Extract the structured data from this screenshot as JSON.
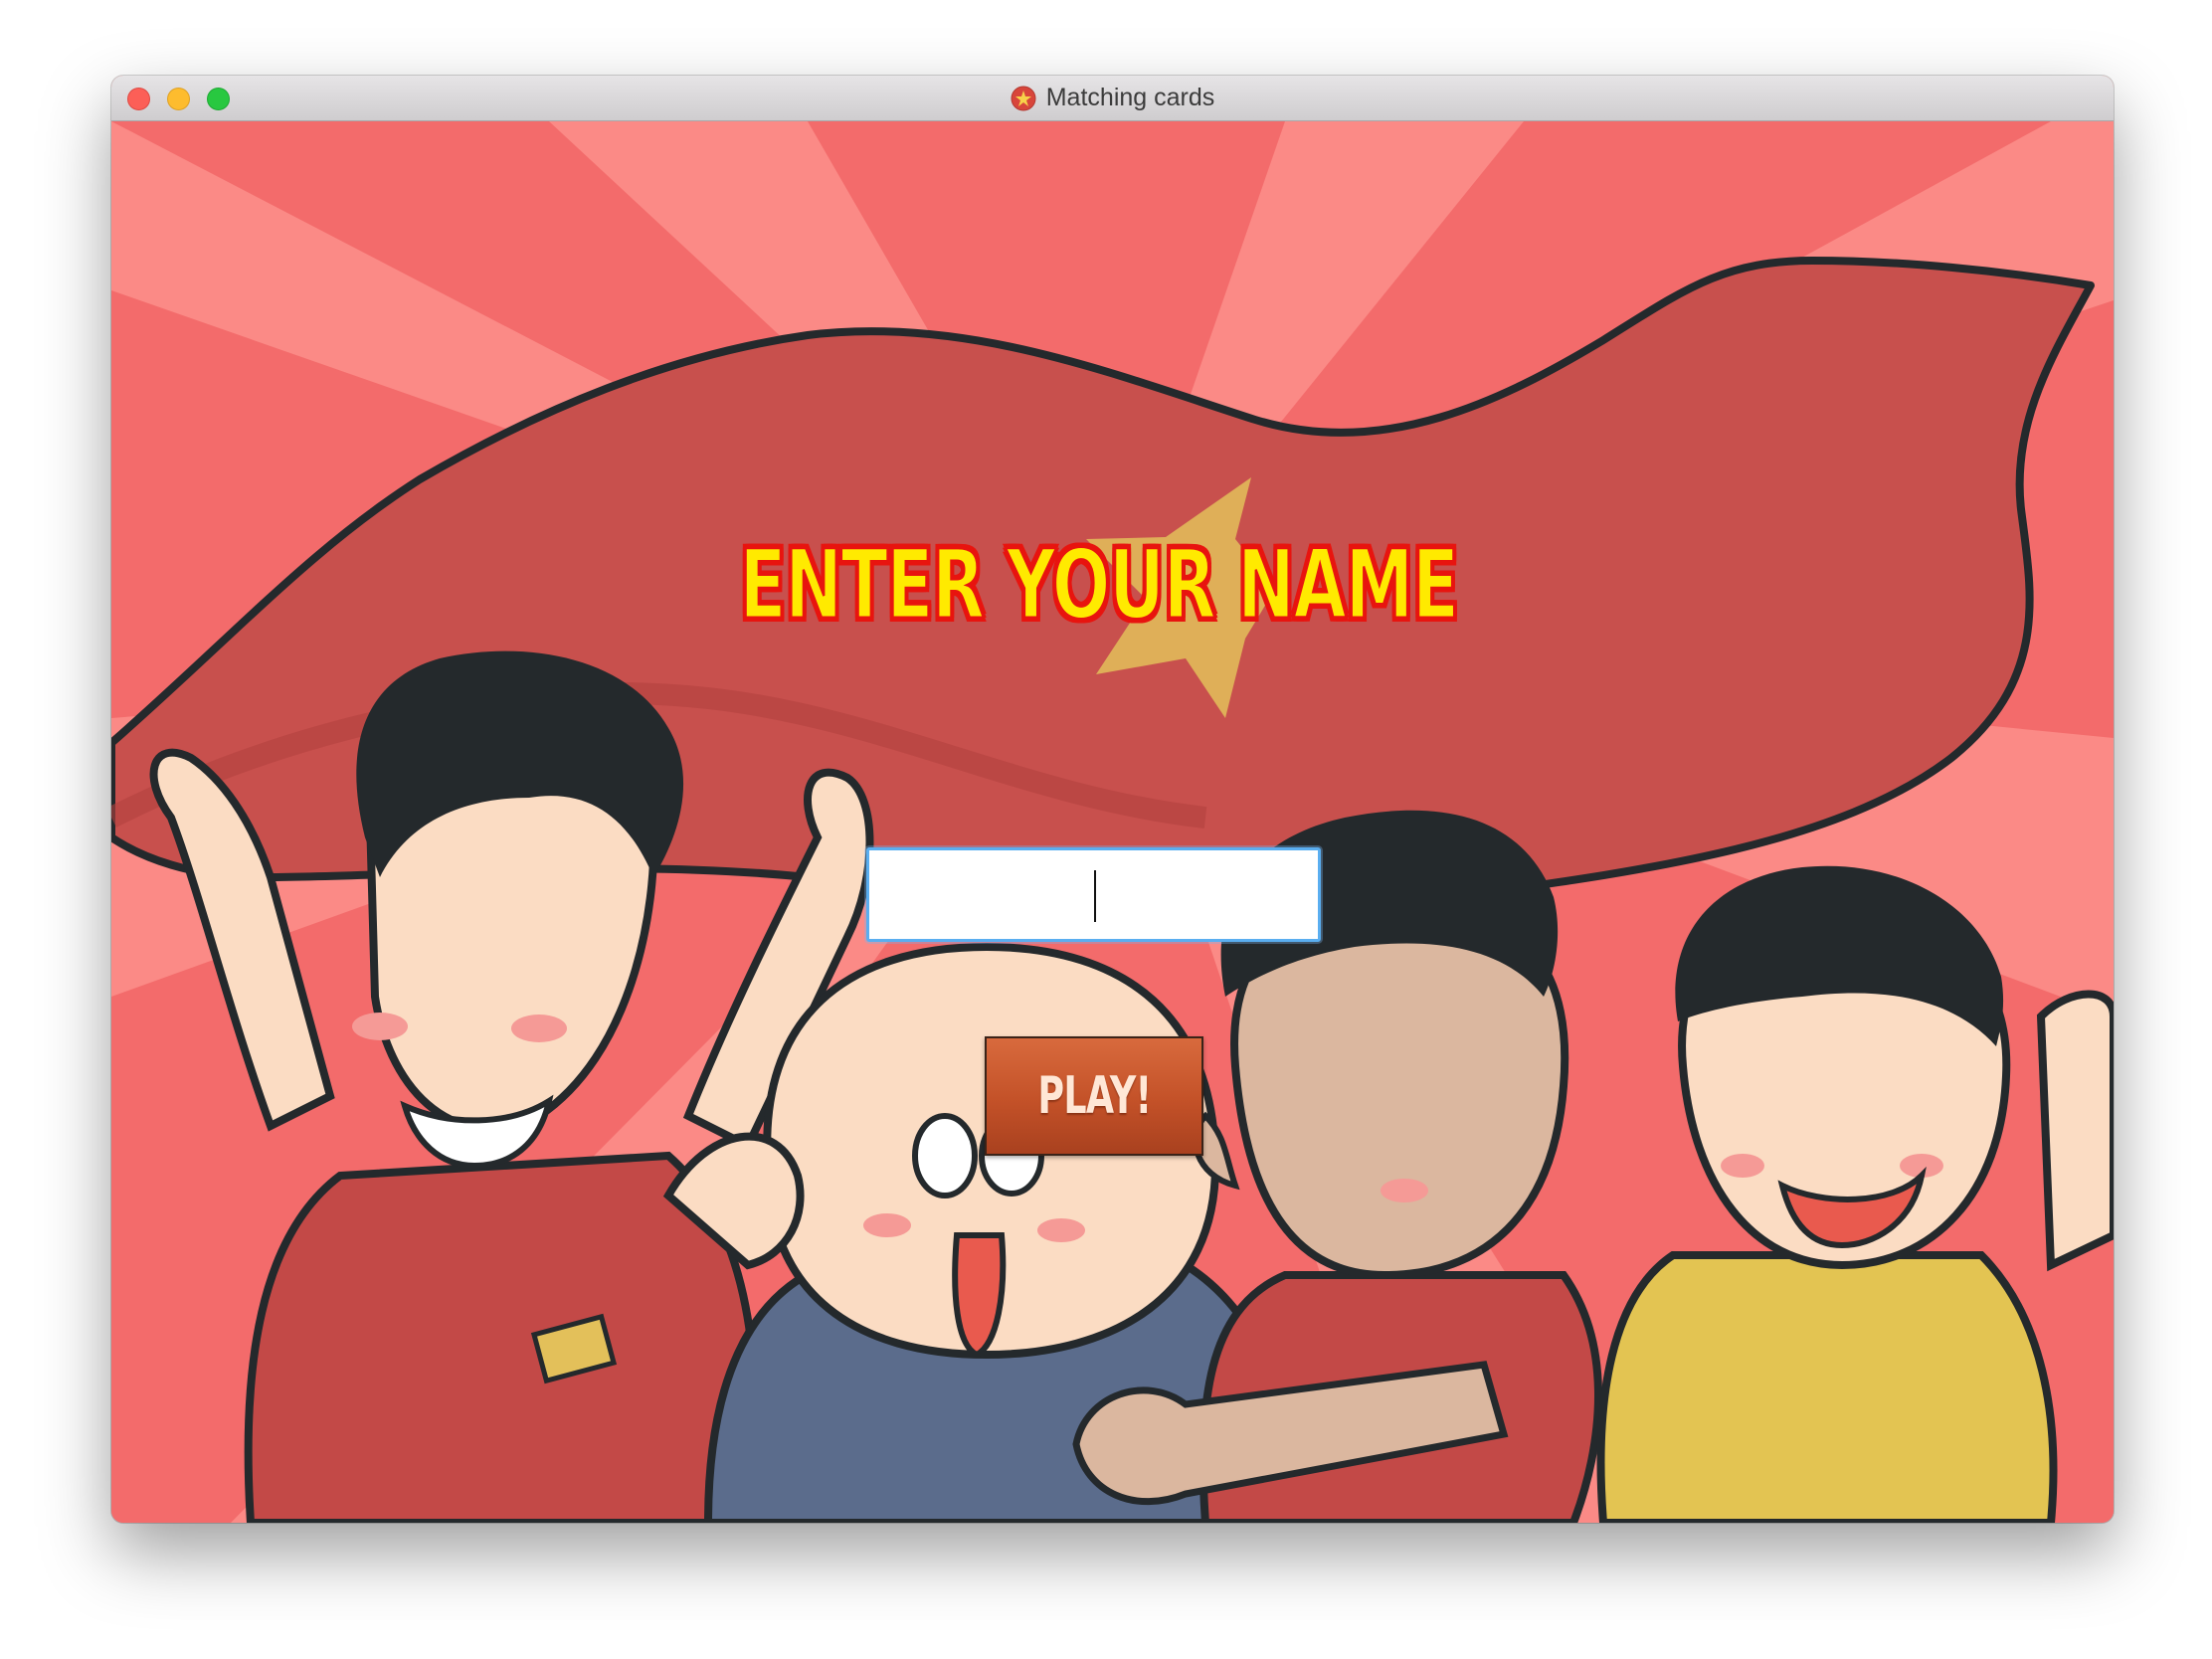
{
  "window": {
    "title": "Matching cards",
    "app_icon": "vietnam-flag-icon",
    "traffic_lights": [
      "close",
      "minimize",
      "zoom"
    ]
  },
  "screen": {
    "heading": "ENTER YOUR NAME",
    "name_input": {
      "value": "",
      "placeholder": ""
    },
    "play_label": "PLAY!",
    "background": "cartoon-football-fans-with-vietnam-flag"
  },
  "colors": {
    "heading_fill": "#ffea00",
    "heading_stroke": "#e8140f",
    "button": "#c35128",
    "background": "#f36b6b",
    "flag": "#c8504d",
    "star": "#e3c05a"
  }
}
